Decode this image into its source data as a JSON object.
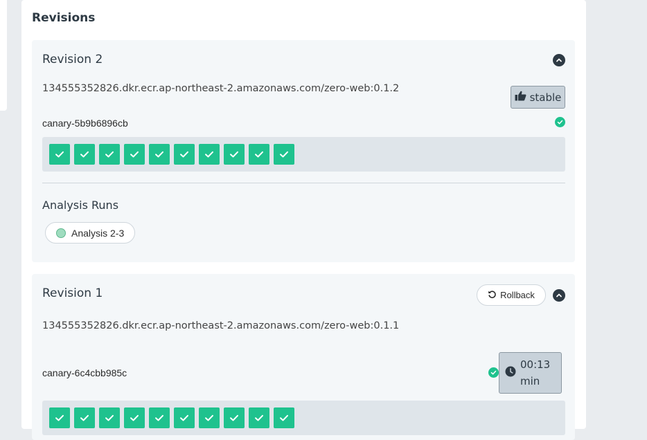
{
  "panel": {
    "title": "Revisions"
  },
  "revisions": [
    {
      "title": "Revision 2",
      "image": "134555352826.dkr.ecr.ap-northeast-2.amazonaws.com/zero-web:0.1.2",
      "badge": {
        "label": "stable",
        "icon": "thumbs-up-icon"
      },
      "replicaset": {
        "name": "canary-5b9b6896cb",
        "status": "healthy",
        "pods": [
          "ok",
          "ok",
          "ok",
          "ok",
          "ok",
          "ok",
          "ok",
          "ok",
          "ok",
          "ok"
        ]
      },
      "analysis_runs": {
        "title": "Analysis Runs",
        "items": [
          {
            "label": "Analysis 2-3",
            "status": "successful"
          }
        ]
      }
    },
    {
      "title": "Revision 1",
      "image": "134555352826.dkr.ecr.ap-northeast-2.amazonaws.com/zero-web:0.1.1",
      "rollback_label": "Rollback",
      "timer": {
        "line1": "00:13",
        "line2": "min",
        "icon": "clock-icon"
      },
      "replicaset": {
        "name": "canary-6c4cbb985c",
        "status": "healthy",
        "pods": [
          "ok",
          "ok",
          "ok",
          "ok",
          "ok",
          "ok",
          "ok",
          "ok",
          "ok",
          "ok"
        ]
      }
    }
  ],
  "colors": {
    "success": "#1fc28e",
    "badge_bg": "#c8d2da",
    "heading": "#2e3a44"
  }
}
